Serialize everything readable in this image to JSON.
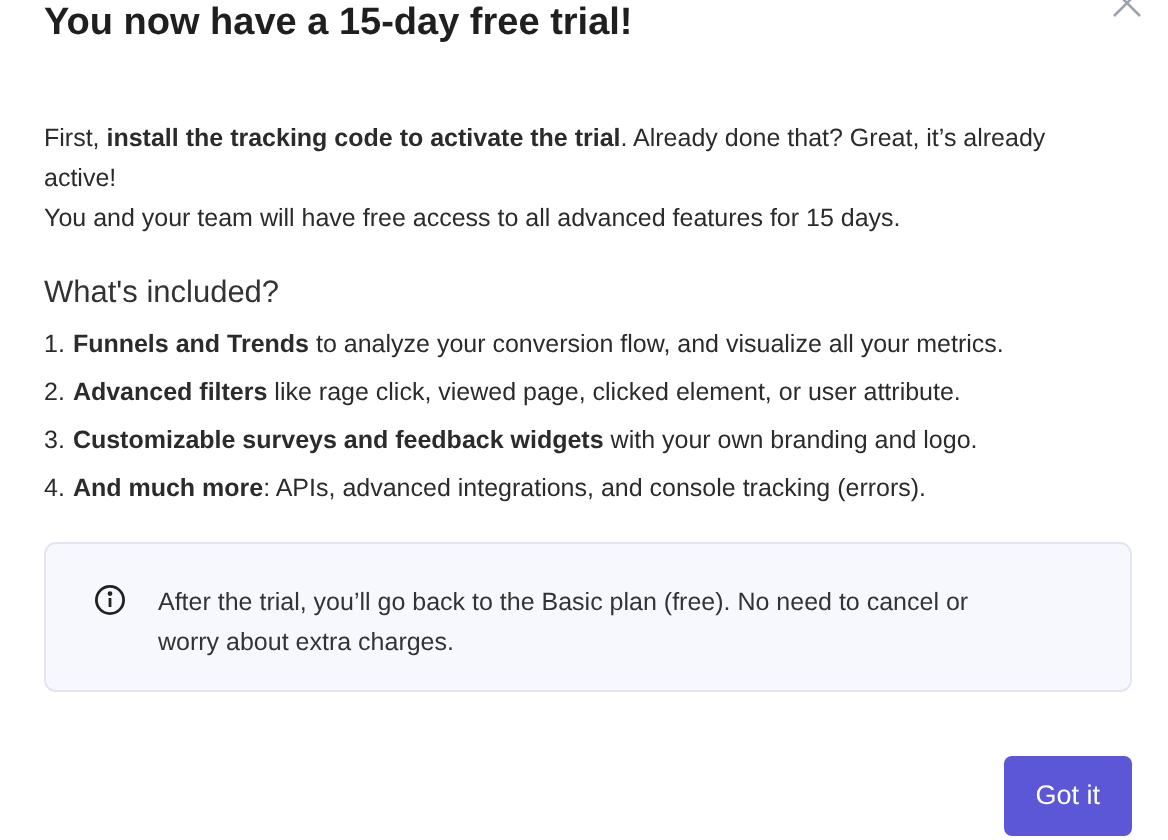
{
  "dialog": {
    "title": "You now have a 15-day free trial!",
    "paragraphs": [
      "First, **install the tracking code to activate the trial**. Already done that? Great, it’s already active!",
      "You and your team will have free access to all advanced features for 15 days."
    ],
    "section_heading": "What's included?",
    "features": [
      {
        "number": "1.",
        "text": "**Funnels and Trends** to analyze your conversion flow, and visualize all your metrics."
      },
      {
        "number": "2.",
        "text": "**Advanced filters** like rage click, viewed page, clicked element, or user attribute."
      },
      {
        "number": "3.",
        "text": "**Customizable surveys and feedback widgets** with your own branding and logo."
      },
      {
        "number": "4.",
        "text": "**And much more**: APIs, advanced integrations, and console tracking (errors)."
      }
    ],
    "notice": "After the trial, you’ll go back to the Basic plan (free). No need to cancel or worry about extra charges.",
    "buttons": [
      "Got it"
    ]
  }
}
